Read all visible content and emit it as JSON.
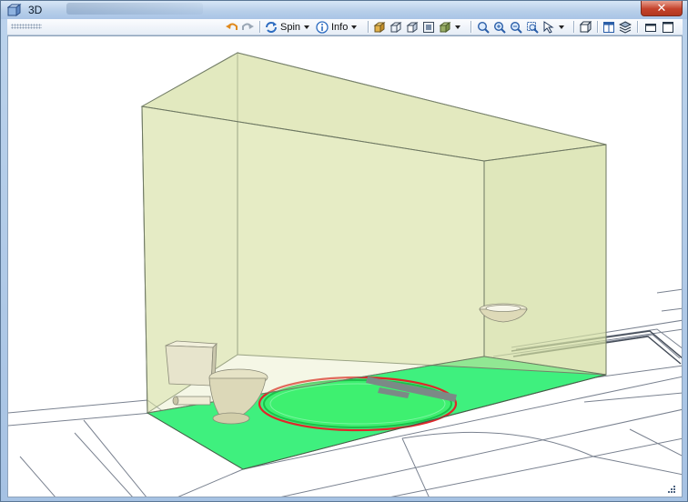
{
  "window": {
    "title": "3D",
    "close_label": "✕"
  },
  "toolbar": {
    "spin_label": "Spin",
    "info_label": "Info"
  },
  "icons": {
    "app": "3d-view-icon",
    "undo": "undo-icon",
    "redo": "redo-icon",
    "spin": "spin-icon",
    "info": "info-icon",
    "view_modes": [
      "shaded-view-icon",
      "wireframe-view-icon",
      "hidden-line-view-icon",
      "section-box-icon",
      "material-icon"
    ],
    "zoom": [
      "zoom-extents-icon",
      "zoom-in-icon",
      "zoom-out-icon",
      "zoom-window-icon",
      "pick-icon"
    ],
    "misc": [
      "perspective-icon",
      "layout-icon",
      "layers-icon",
      "restore-window-icon",
      "maximize-window-icon"
    ]
  },
  "colors": {
    "room_volume": "#d9e2a6",
    "floor_fill": "#3ff07e",
    "turning_circle": "#2ee65f",
    "circle_outline": "#e0262a"
  }
}
